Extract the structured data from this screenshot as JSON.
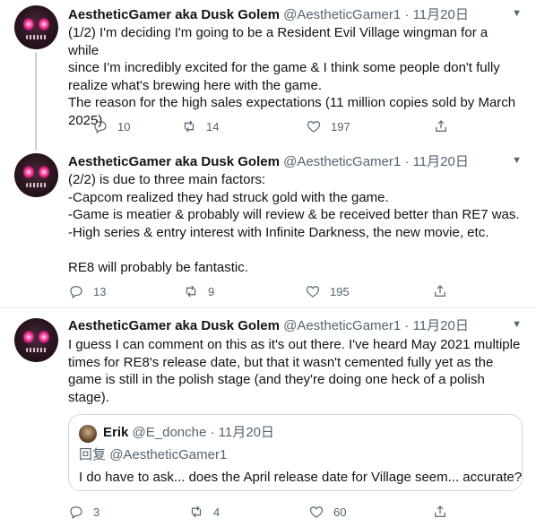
{
  "tweets": [
    {
      "name": "AestheticGamer aka Dusk Golem",
      "handle": "@AestheticGamer1",
      "separator": "·",
      "date": "11月20日",
      "lines": [
        "(1/2) I'm deciding I'm going to be a Resident Evil Village wingman for a while",
        "since I'm incredibly excited for the game & I think some people don't fully",
        "realize what's brewing here with the game.",
        "The reason for the high sales expectations (11 million copies sold by March",
        "2025)"
      ],
      "replies": "10",
      "retweets": "14",
      "likes": "197"
    },
    {
      "name": "AestheticGamer aka Dusk Golem",
      "handle": "@AestheticGamer1",
      "separator": "·",
      "date": "11月20日",
      "lines": [
        "(2/2) is due to three main factors:",
        "-Capcom realized they had struck gold with the game.",
        "-Game is meatier & probably will review & be received better than RE7 was.",
        "-High series & entry interest with Infinite Darkness, the new movie, etc.",
        "",
        "RE8 will probably be fantastic."
      ],
      "replies": "13",
      "retweets": "9",
      "likes": "195"
    },
    {
      "name": "AestheticGamer aka Dusk Golem",
      "handle": "@AestheticGamer1",
      "separator": "·",
      "date": "11月20日",
      "lines": [
        "I guess I can comment on this as it's out there. I've heard May 2021 multiple",
        "times for RE8's release date, but that it wasn't cemented fully yet as the",
        "game is still in the polish stage (and they're doing one heck of a polish",
        "stage)."
      ],
      "replies": "3",
      "retweets": "4",
      "likes": "60",
      "quote": {
        "name": "Erik",
        "handle": "@E_donche",
        "separator": "·",
        "date": "11月20日",
        "reply_prefix": "回复",
        "reply_mention": "@AestheticGamer1",
        "text": "I do have to ask... does the April release date for Village seem... accurate?"
      }
    }
  ],
  "icons": {
    "reply": "reply-icon",
    "retweet": "retweet-icon",
    "like": "heart-icon",
    "share": "share-icon",
    "more": "chevron-down-icon"
  }
}
